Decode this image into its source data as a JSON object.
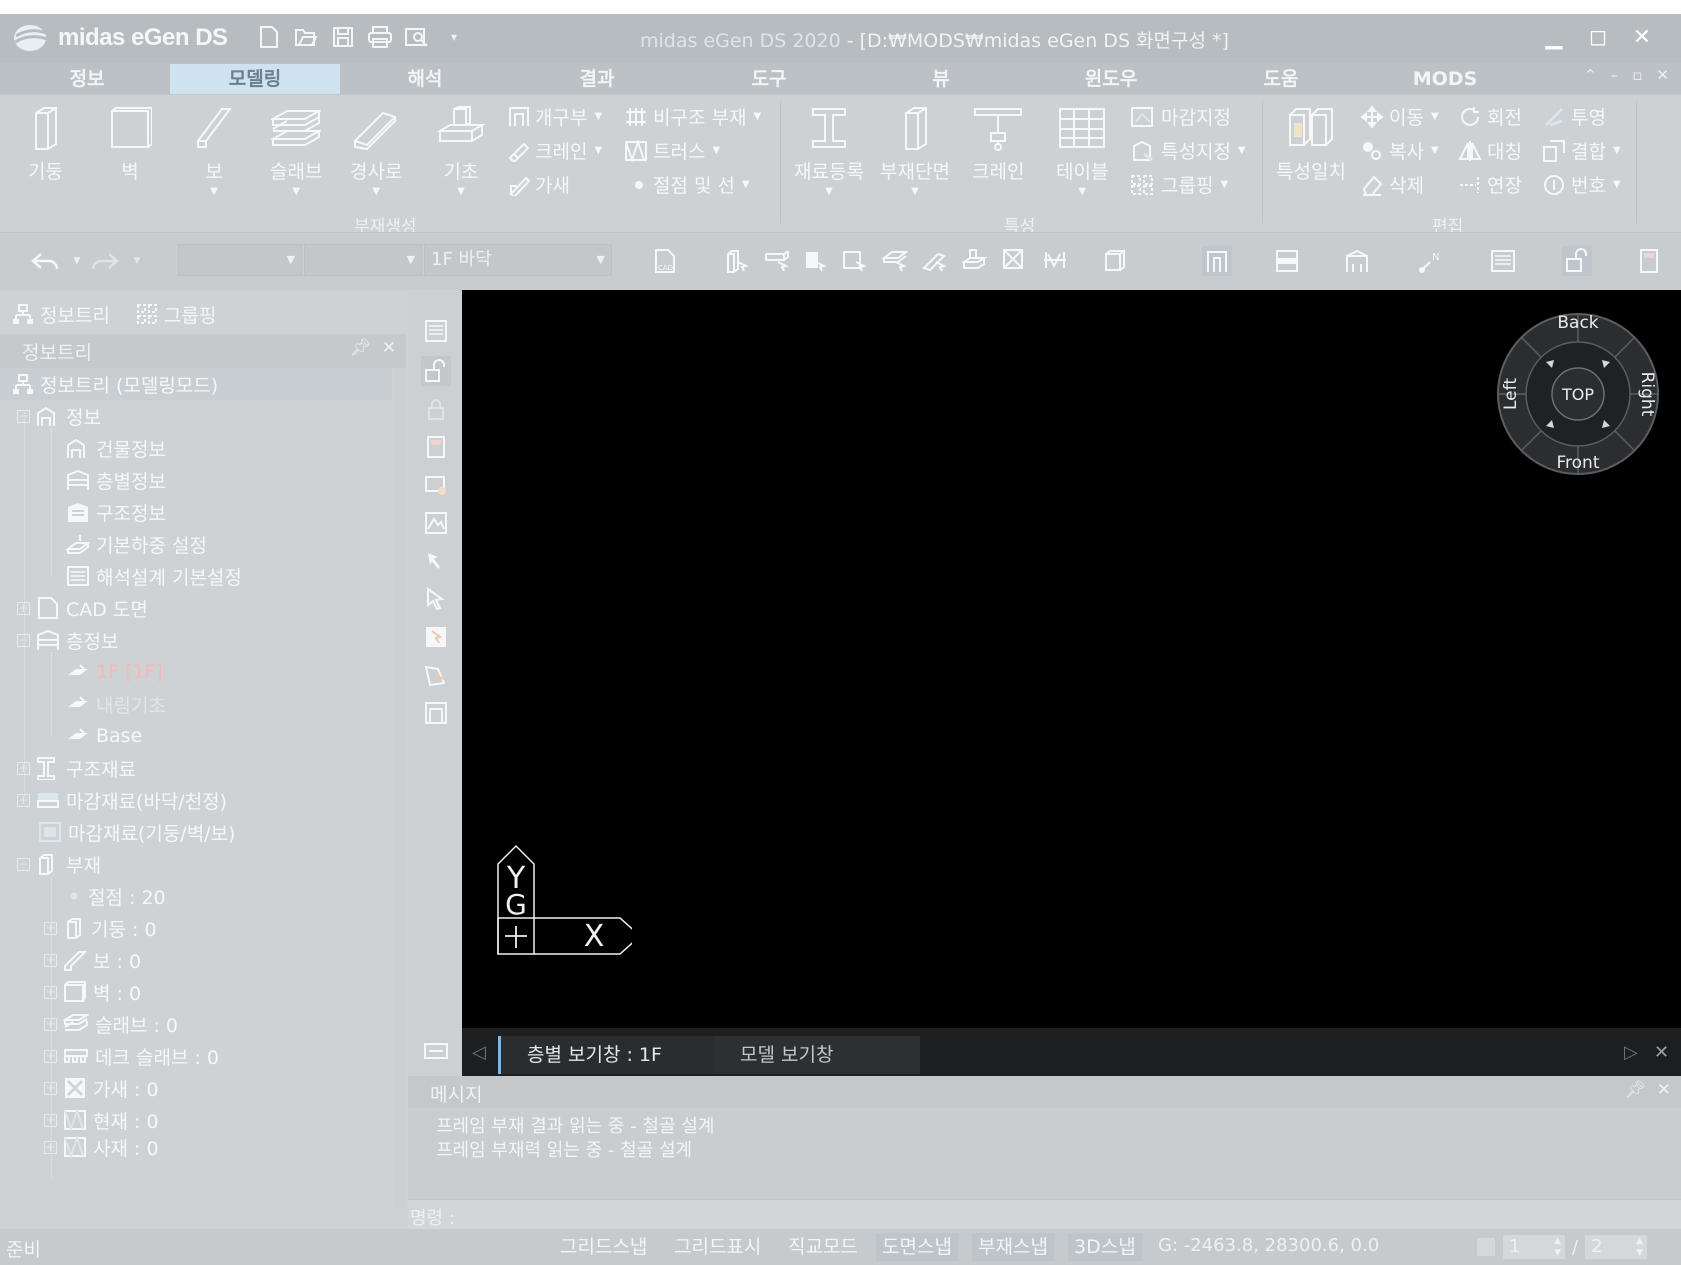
{
  "app": {
    "logo_text": "midas eGen DS",
    "window_title": "midas eGen DS 2020 - [D:\\MODS\\midas eGen DS 화면구성 *]",
    "window_title_app": "midas eGen DS 2020",
    "window_title_path": " - [D:₩MODS₩midas eGen DS 화면구성 *]"
  },
  "ribbon_tabs": [
    "정보",
    "모델링",
    "해석",
    "결과",
    "도구",
    "뷰",
    "윈도우",
    "도움",
    "MODS"
  ],
  "active_tab": "모델링",
  "ribbon": {
    "member_group": {
      "label": "부재생성",
      "large_buttons": [
        "기둥",
        "벽",
        "보",
        "슬래브",
        "경사로",
        "기초"
      ],
      "small_buttons": [
        "개구부",
        "크레인",
        "가새",
        "비구조 부재",
        "트러스",
        "절점 및 선"
      ]
    },
    "property_group": {
      "label": "특성",
      "large_buttons": [
        "재료등록",
        "부재단면",
        "크레인",
        "테이블"
      ],
      "small_buttons": [
        "마감지정",
        "특성지정",
        "그룹핑"
      ]
    },
    "edit_group": {
      "label": "편집",
      "large_buttons": [
        "특성일치"
      ],
      "small_buttons": [
        "이동",
        "회전",
        "투영",
        "복사",
        "대칭",
        "결합",
        "삭제",
        "연장",
        "번호"
      ]
    }
  },
  "toolbar": {
    "combo1": "",
    "combo2": "",
    "floor_combo": "1F 바닥"
  },
  "left_panel": {
    "tabs": [
      "정보트리",
      "그룹핑"
    ],
    "header": "정보트리",
    "tree": {
      "root": "정보트리 (모델링모드)",
      "info": "정보",
      "info_children": [
        "건물정보",
        "층별정보",
        "구조정보",
        "기본하중 설정",
        "해석설계 기본설정"
      ],
      "cad": "CAD 도면",
      "floor_info": "층정보",
      "floors": [
        "1F [1F]",
        "내림기초",
        "Base"
      ],
      "material": "구조재료",
      "finish_floor": "마감재료(바닥/천정)",
      "finish_wall": "마감재료(기둥/벽/보)",
      "members": "부재",
      "member_children": [
        "절점 : 20",
        "기둥 : 0",
        "보 : 0",
        "벽 : 0",
        "슬래브 : 0",
        "데크 슬래브 : 0",
        "가새 : 0",
        "현재 : 0",
        "사재 : 0"
      ]
    }
  },
  "viewcube": {
    "center": "TOP",
    "back": "Back",
    "front": "Front",
    "left": "Left",
    "right": "Right"
  },
  "axis": {
    "y": "Y",
    "g": "G",
    "x": "X"
  },
  "view_tabs": [
    "층별 보기창 : 1F",
    "모델 보기창"
  ],
  "message_pane": {
    "title": "메시지",
    "lines": [
      "프레임 부재 결과 읽는 중 - 철골 설계",
      "프레임 부재력 읽는 중 - 철골 설계"
    ],
    "command_label": "명령 :",
    "command_value": ""
  },
  "status_bar": {
    "ready": "준비",
    "toggles": [
      "그리드스냅",
      "그리드표시",
      "직교모드",
      "도면스냅",
      "부재스냅",
      "3D스냅"
    ],
    "toggles_on": [
      "도면스냅",
      "부재스냅",
      "3D스냅"
    ],
    "coords": "G: -2463.8, 28300.6, 0.0",
    "page_current": "1",
    "page_sep": "/",
    "page_total": "2"
  },
  "colors": {
    "canvas": "#000000",
    "active_tab": "#cfe2ef",
    "selected_floor": "#f4b8b2"
  }
}
